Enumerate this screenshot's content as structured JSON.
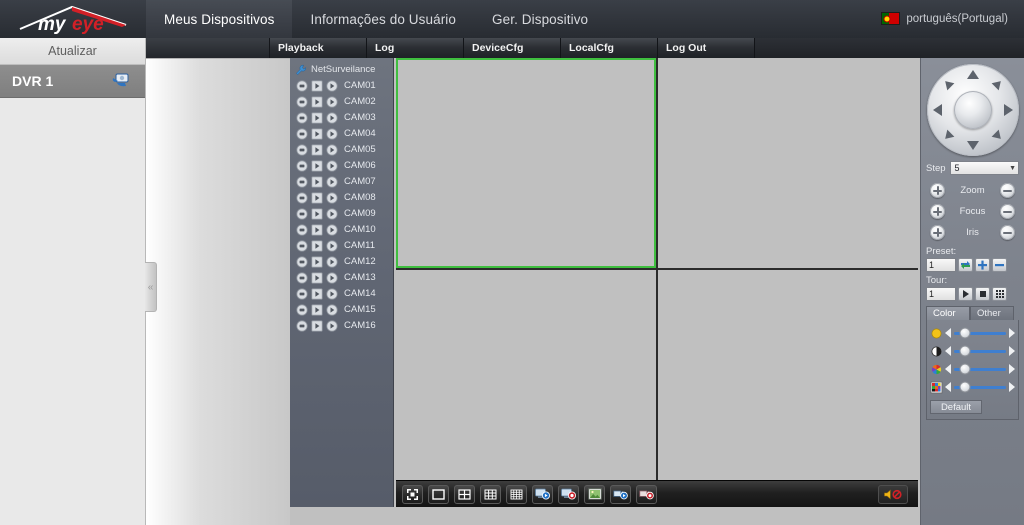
{
  "header": {
    "logo_text": "myeye",
    "nav": [
      {
        "label": "Meus Dispositivos",
        "active": true
      },
      {
        "label": "Informações do Usuário",
        "active": false
      },
      {
        "label": "Ger. Dispositivo",
        "active": false
      }
    ],
    "language": {
      "label": "português(Portugal)",
      "flag": "portugal-flag-icon"
    }
  },
  "subtabs": [
    {
      "label": "Playback"
    },
    {
      "label": "Log"
    },
    {
      "label": "DeviceCfg"
    },
    {
      "label": "LocalCfg"
    },
    {
      "label": "Log Out"
    }
  ],
  "sidebar": {
    "refresh_label": "Atualizar",
    "devices": [
      {
        "label": "DVR 1",
        "icon": "dvr-camera-icon"
      }
    ],
    "collapse_label": "«"
  },
  "tree": {
    "root_label": "NetSurveilance",
    "root_icon": "wrench-icon",
    "cameras": [
      {
        "label": "CAM01"
      },
      {
        "label": "CAM02"
      },
      {
        "label": "CAM03"
      },
      {
        "label": "CAM04"
      },
      {
        "label": "CAM05"
      },
      {
        "label": "CAM06"
      },
      {
        "label": "CAM07"
      },
      {
        "label": "CAM08"
      },
      {
        "label": "CAM09"
      },
      {
        "label": "CAM10"
      },
      {
        "label": "CAM11"
      },
      {
        "label": "CAM12"
      },
      {
        "label": "CAM13"
      },
      {
        "label": "CAM14"
      },
      {
        "label": "CAM15"
      },
      {
        "label": "CAM16"
      }
    ],
    "row_icons": [
      "stop-circle-icon",
      "play-square-icon",
      "play-circle-icon"
    ]
  },
  "video": {
    "panes": [
      {
        "selected": true
      },
      {
        "selected": false
      },
      {
        "selected": false
      },
      {
        "selected": false
      }
    ],
    "selection_color": "#3fbf3f",
    "pane_color": "#c0c0c0",
    "toolbar": [
      {
        "icon": "fullscreen-icon"
      },
      {
        "icon": "single-view-icon"
      },
      {
        "icon": "quad-view-icon"
      },
      {
        "icon": "nine-view-icon"
      },
      {
        "icon": "sixteen-view-icon"
      },
      {
        "icon": "local-playback-icon"
      },
      {
        "icon": "local-record-icon"
      },
      {
        "icon": "snapshot-icon"
      },
      {
        "icon": "remote-playback-icon"
      },
      {
        "icon": "remote-record-icon"
      }
    ],
    "mute_icon": "speaker-muted-icon"
  },
  "ptz": {
    "directions": [
      "up",
      "up-right",
      "right",
      "down-right",
      "down",
      "down-left",
      "left",
      "up-left"
    ],
    "step": {
      "label": "Step",
      "value": "5"
    },
    "controls": [
      {
        "label": "Zoom",
        "plus": "plus-icon",
        "minus": "minus-icon"
      },
      {
        "label": "Focus",
        "plus": "plus-icon",
        "minus": "minus-icon"
      },
      {
        "label": "Iris",
        "plus": "plus-icon",
        "minus": "minus-icon"
      }
    ],
    "preset": {
      "label": "Preset:",
      "value": "1",
      "buttons": [
        "goto-preset-icon",
        "add-preset-icon",
        "remove-preset-icon"
      ]
    },
    "tour": {
      "label": "Tour:",
      "value": "1",
      "buttons": [
        "start-tour-icon",
        "stop-tour-icon",
        "tour-list-icon"
      ]
    }
  },
  "color_panel": {
    "tabs": [
      {
        "label": "Color",
        "active": true
      },
      {
        "label": "Other",
        "active": false
      }
    ],
    "sliders": [
      {
        "icon": "brightness-icon",
        "value": 22
      },
      {
        "icon": "contrast-icon",
        "value": 22
      },
      {
        "icon": "saturation-icon",
        "value": 22
      },
      {
        "icon": "hue-icon",
        "value": 22
      }
    ],
    "default_label": "Default"
  }
}
